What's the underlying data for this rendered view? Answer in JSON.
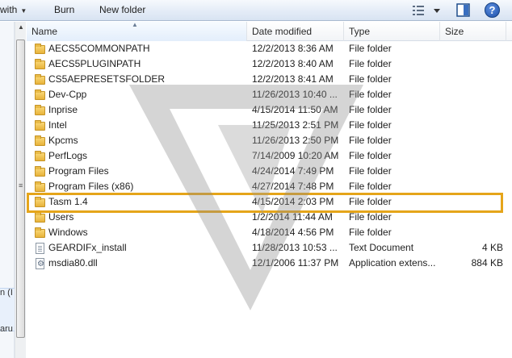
{
  "toolbar": {
    "with_label": "with",
    "burn_label": "Burn",
    "new_folder_label": "New folder",
    "help_label": "?"
  },
  "leftpane": {
    "fragments": [
      "n (I",
      "aru"
    ]
  },
  "columns": {
    "name": "Name",
    "date": "Date modified",
    "type": "Type",
    "size": "Size"
  },
  "files": [
    {
      "name": "AECS5COMMONPATH",
      "date": "12/2/2013 8:36 AM",
      "type": "File folder",
      "size": "",
      "icon": "folder-icon"
    },
    {
      "name": "AECS5PLUGINPATH",
      "date": "12/2/2013 8:40 AM",
      "type": "File folder",
      "size": "",
      "icon": "folder-icon"
    },
    {
      "name": "CS5AEPRESETSFOLDER",
      "date": "12/2/2013 8:41 AM",
      "type": "File folder",
      "size": "",
      "icon": "folder-icon"
    },
    {
      "name": "Dev-Cpp",
      "date": "11/26/2013 10:40 ...",
      "type": "File folder",
      "size": "",
      "icon": "folder-icon"
    },
    {
      "name": "Inprise",
      "date": "4/15/2014 11:50 AM",
      "type": "File folder",
      "size": "",
      "icon": "folder-icon"
    },
    {
      "name": "Intel",
      "date": "11/25/2013 2:51 PM",
      "type": "File folder",
      "size": "",
      "icon": "folder-icon"
    },
    {
      "name": "Kpcms",
      "date": "11/26/2013 2:50 PM",
      "type": "File folder",
      "size": "",
      "icon": "folder-icon"
    },
    {
      "name": "PerfLogs",
      "date": "7/14/2009 10:20 AM",
      "type": "File folder",
      "size": "",
      "icon": "folder-icon"
    },
    {
      "name": "Program Files",
      "date": "4/24/2014 7:49 PM",
      "type": "File folder",
      "size": "",
      "icon": "folder-icon"
    },
    {
      "name": "Program Files (x86)",
      "date": "4/27/2014 7:48 PM",
      "type": "File folder",
      "size": "",
      "icon": "folder-icon"
    },
    {
      "name": "Tasm 1.4",
      "date": "4/15/2014 2:03 PM",
      "type": "File folder",
      "size": "",
      "icon": "folder-icon"
    },
    {
      "name": "Users",
      "date": "1/2/2014 11:44 AM",
      "type": "File folder",
      "size": "",
      "icon": "folder-icon"
    },
    {
      "name": "Windows",
      "date": "4/18/2014 4:56 PM",
      "type": "File folder",
      "size": "",
      "icon": "folder-icon"
    },
    {
      "name": "GEARDIFx_install",
      "date": "11/28/2013 10:53 ...",
      "type": "Text Document",
      "size": "4 KB",
      "icon": "document-icon"
    },
    {
      "name": "msdia80.dll",
      "date": "12/1/2006 11:37 PM",
      "type": "Application extens...",
      "size": "884 KB",
      "icon": "dll-file-icon"
    }
  ],
  "highlight": {
    "row_name": "Tasm 1.4",
    "color": "#e5a51a"
  }
}
